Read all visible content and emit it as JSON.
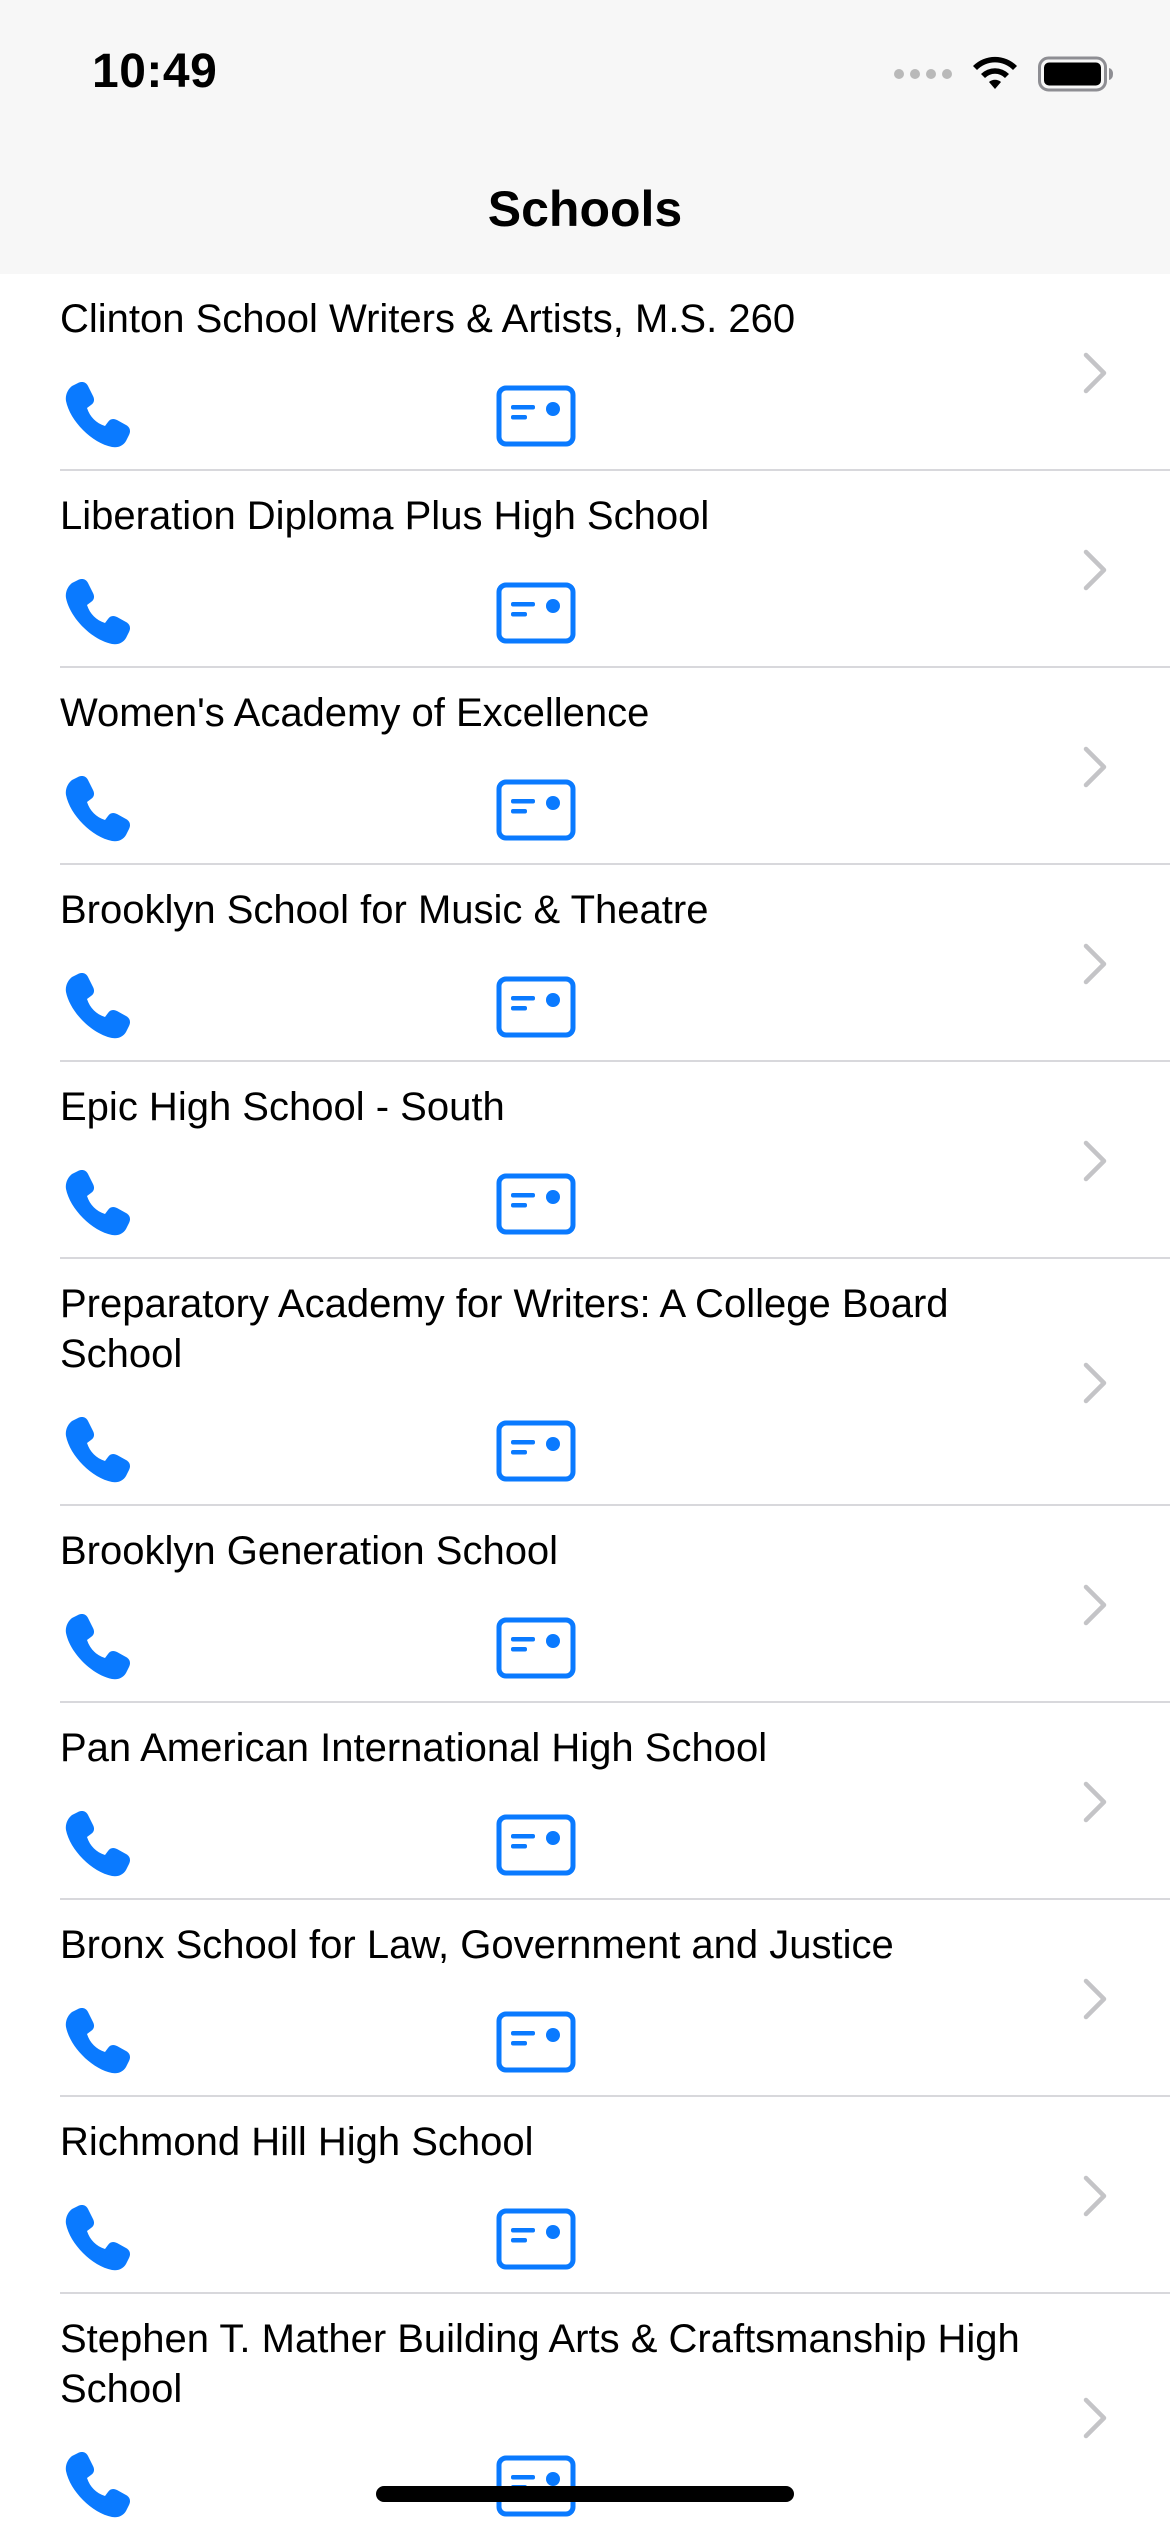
{
  "status_bar": {
    "time": "10:49",
    "icons": [
      "cellular-signal-icon",
      "wifi-icon",
      "battery-icon"
    ]
  },
  "nav": {
    "title": "Schools"
  },
  "colors": {
    "accent": "#0a7aff",
    "chevron": "#c4c4c7",
    "separator": "#d8d8dc",
    "bar_background": "#f7f7f7"
  },
  "row_icons": {
    "phone": "phone-icon",
    "card": "contact-card-icon",
    "chevron": "chevron-right-icon"
  },
  "schools": [
    {
      "name": "Clinton School Writers & Artists, M.S. 260"
    },
    {
      "name": "Liberation Diploma Plus High School"
    },
    {
      "name": "Women's Academy of Excellence"
    },
    {
      "name": "Brooklyn School for Music & Theatre"
    },
    {
      "name": "Epic High School - South"
    },
    {
      "name": "Preparatory Academy for Writers: A College Board School"
    },
    {
      "name": "Brooklyn Generation School"
    },
    {
      "name": "Pan American International High School"
    },
    {
      "name": "Bronx School for Law, Government and Justice"
    },
    {
      "name": "Richmond Hill High School"
    },
    {
      "name": "Stephen T. Mather Building Arts & Craftsmanship High School"
    }
  ]
}
